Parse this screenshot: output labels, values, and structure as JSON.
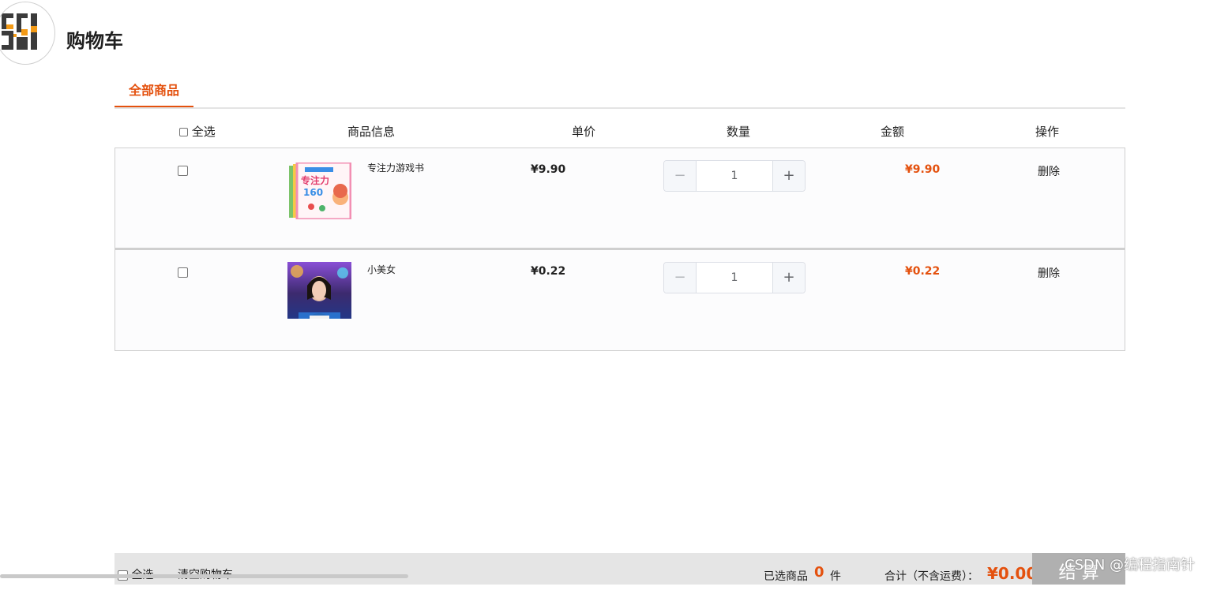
{
  "page": {
    "title": "购物车"
  },
  "tabs": [
    {
      "label": "全部商品",
      "active": true
    }
  ],
  "table": {
    "headers": {
      "select_all": "全选",
      "info": "商品信息",
      "unit_price": "单价",
      "quantity": "数量",
      "amount": "金额",
      "action": "操作"
    },
    "items": [
      {
        "name": "专注力游戏书",
        "price": "¥9.90",
        "quantity": "1",
        "total": "¥9.90",
        "delete": "删除",
        "minus": "−",
        "plus": "+"
      },
      {
        "name": "小美女",
        "price": "¥0.22",
        "quantity": "1",
        "total": "¥0.22",
        "delete": "删除",
        "minus": "−",
        "plus": "+"
      }
    ]
  },
  "footer": {
    "select_all": "全选",
    "clear": "清空购物车",
    "selected_label": "已选商品",
    "selected_count": "0",
    "selected_unit": "件",
    "sum_label": "合计（不含运费）：",
    "sum": "¥0.00",
    "checkout": "结 算"
  },
  "watermark": "CSDN @编程指南针",
  "colors": {
    "accent": "#e4510e",
    "checkout_disabled": "#b0b0b0",
    "footer_bg": "#e5e5e5"
  }
}
